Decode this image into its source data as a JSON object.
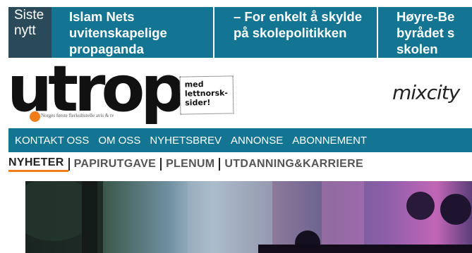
{
  "ticker": {
    "label_line1": "Siste",
    "label_line2": "nytt",
    "items": [
      {
        "lines": [
          "Islam Nets",
          "uvitenskapelige",
          "propaganda"
        ]
      },
      {
        "lines": [
          "– For enkelt å skylde",
          "på skolepolitikken"
        ]
      },
      {
        "lines": [
          "Høyre-Be",
          "byrådet s",
          "skolen"
        ]
      }
    ]
  },
  "logo": {
    "text": "utrop",
    "tagline": "Norges første flerkulturelle avis & tv",
    "badge_lines": [
      "med",
      "lettnorsk-",
      "sider!"
    ],
    "partner": "mixcity"
  },
  "main_nav": [
    "KONTAKT OSS",
    "OM OSS",
    "NYHETSBREV",
    "ANNONSE",
    "ABONNEMENT"
  ],
  "section_nav": [
    "NYHETER",
    "PAPIRUTGAVE",
    "PLENUM",
    "UTDANNING&KARRIERE"
  ],
  "colors": {
    "brand_teal": "#147592",
    "ticker_label_bg": "#2a4a5a",
    "accent_orange": "#ef7d1a"
  }
}
